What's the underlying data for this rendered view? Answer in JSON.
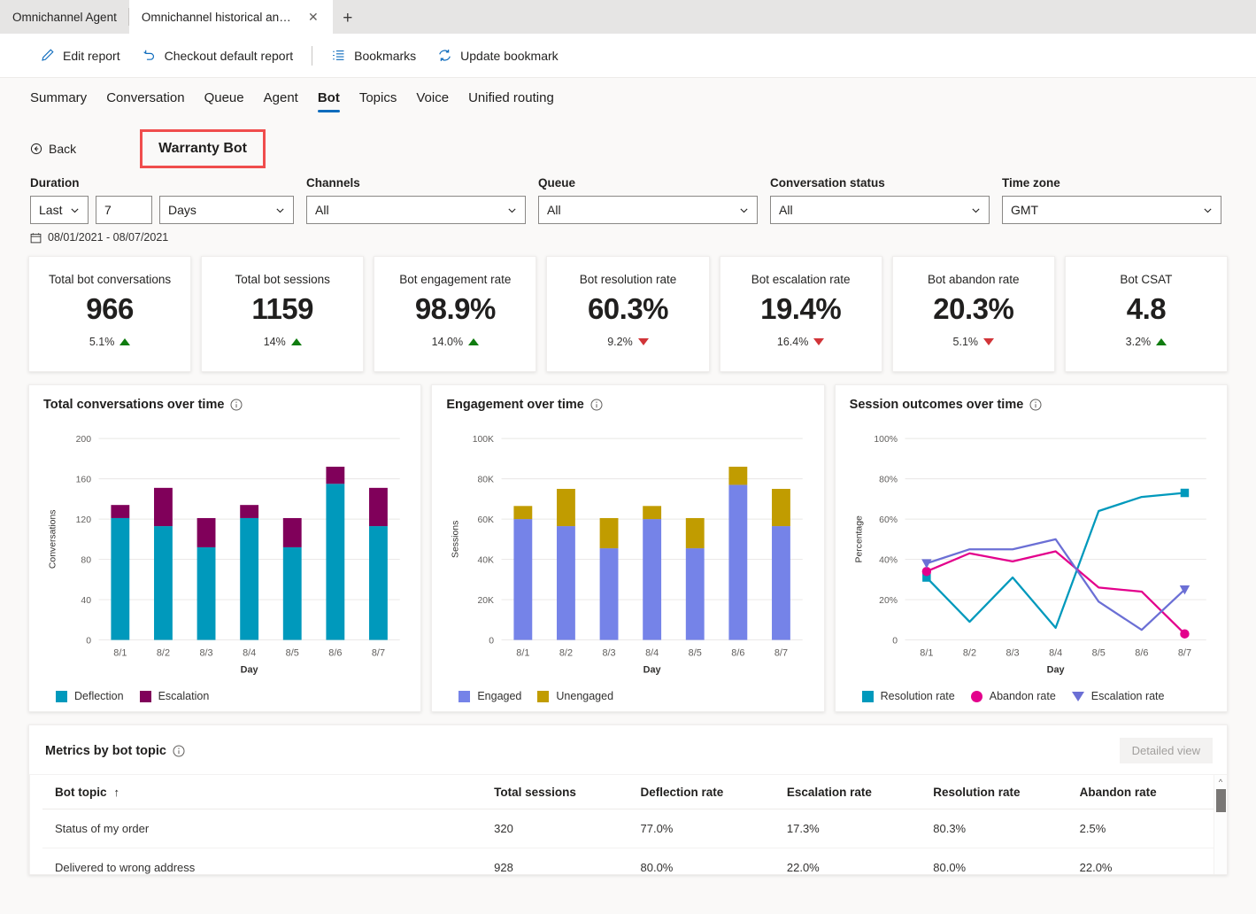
{
  "browser": {
    "tabs": [
      {
        "label": "Omnichannel Agent",
        "active": false
      },
      {
        "label": "Omnichannel historical ana...",
        "active": true
      }
    ],
    "close_label": "✕",
    "new_tab_label": "+"
  },
  "toolbar": {
    "items": [
      {
        "label": "Edit report",
        "icon": "pencil-icon"
      },
      {
        "label": "Checkout default report",
        "icon": "undo-icon"
      },
      {
        "label": "Bookmarks",
        "icon": "list-icon"
      },
      {
        "label": "Update bookmark",
        "icon": "refresh-icon"
      }
    ]
  },
  "nav": {
    "tabs": [
      {
        "label": "Summary",
        "active": false
      },
      {
        "label": "Conversation",
        "active": false
      },
      {
        "label": "Queue",
        "active": false
      },
      {
        "label": "Agent",
        "active": false
      },
      {
        "label": "Bot",
        "active": true
      },
      {
        "label": "Topics",
        "active": false
      },
      {
        "label": "Voice",
        "active": false
      },
      {
        "label": "Unified routing",
        "active": false
      }
    ]
  },
  "header": {
    "back_label": "Back",
    "bot_title": "Warranty Bot",
    "highlight_color": "#f04d4d"
  },
  "filters": {
    "duration": {
      "label": "Duration",
      "mode": "Last",
      "amount": "7",
      "unit": "Days",
      "date_range": "08/01/2021 - 08/07/2021"
    },
    "channels": {
      "label": "Channels",
      "value": "All"
    },
    "queue": {
      "label": "Queue",
      "value": "All"
    },
    "conversation_status": {
      "label": "Conversation status",
      "value": "All"
    },
    "time_zone": {
      "label": "Time zone",
      "value": "GMT"
    }
  },
  "kpis": [
    {
      "label": "Total bot conversations",
      "value": "966",
      "delta": "5.1%",
      "direction": "up"
    },
    {
      "label": "Total bot sessions",
      "value": "1159",
      "delta": "14%",
      "direction": "up"
    },
    {
      "label": "Bot engagement rate",
      "value": "98.9%",
      "delta": "14.0%",
      "direction": "up"
    },
    {
      "label": "Bot resolution rate",
      "value": "60.3%",
      "delta": "9.2%",
      "direction": "down"
    },
    {
      "label": "Bot escalation rate",
      "value": "19.4%",
      "delta": "16.4%",
      "direction": "down"
    },
    {
      "label": "Bot abandon rate",
      "value": "20.3%",
      "delta": "5.1%",
      "direction": "down"
    },
    {
      "label": "Bot CSAT",
      "value": "4.8",
      "delta": "3.2%",
      "direction": "up"
    }
  ],
  "chart_data": [
    {
      "type": "bar",
      "stacked": true,
      "title": "Total conversations over time",
      "xlabel": "Day",
      "ylabel": "Conversations",
      "categories": [
        "8/1",
        "8/2",
        "8/3",
        "8/4",
        "8/5",
        "8/6",
        "8/7"
      ],
      "ylim": [
        0,
        200
      ],
      "yticks": [
        0,
        40,
        80,
        120,
        160,
        200
      ],
      "ytick_labels": [
        "0",
        "40",
        "80",
        "120",
        "160",
        "200"
      ],
      "grid": true,
      "legend_position": "bottom",
      "series": [
        {
          "name": "Deflection",
          "color": "#0099bc",
          "values": [
            121,
            113,
            92,
            121,
            92,
            155,
            113
          ]
        },
        {
          "name": "Escalation",
          "color": "#80005a",
          "values": [
            13,
            38,
            29,
            13,
            29,
            17,
            38
          ]
        }
      ]
    },
    {
      "type": "bar",
      "stacked": true,
      "title": "Engagement over time",
      "xlabel": "Day",
      "ylabel": "Sessions",
      "categories": [
        "8/1",
        "8/2",
        "8/3",
        "8/4",
        "8/5",
        "8/6",
        "8/7"
      ],
      "ylim": [
        0,
        100000
      ],
      "yticks": [
        0,
        20000,
        40000,
        60000,
        80000,
        100000
      ],
      "ytick_labels": [
        "0",
        "20K",
        "40K",
        "60K",
        "80K",
        "100K"
      ],
      "grid": true,
      "legend_position": "bottom",
      "series": [
        {
          "name": "Engaged",
          "color": "#7583e8",
          "values": [
            60000,
            56500,
            45500,
            60000,
            45500,
            77000,
            56500
          ]
        },
        {
          "name": "Unengaged",
          "color": "#c19c00",
          "values": [
            6500,
            18500,
            15000,
            6500,
            15000,
            9000,
            18500
          ]
        }
      ]
    },
    {
      "type": "line",
      "title": "Session outcomes over time",
      "xlabel": "Day",
      "ylabel": "Percentage",
      "categories": [
        "8/1",
        "8/2",
        "8/3",
        "8/4",
        "8/5",
        "8/6",
        "8/7"
      ],
      "ylim": [
        0,
        100
      ],
      "yticks": [
        0,
        20,
        40,
        60,
        80,
        100
      ],
      "ytick_labels": [
        "0",
        "20%",
        "40%",
        "60%",
        "80%",
        "100%"
      ],
      "grid": true,
      "legend_position": "bottom",
      "series": [
        {
          "name": "Resolution rate",
          "color": "#0099bc",
          "marker": "square",
          "values": [
            31,
            9,
            31,
            6,
            64,
            71,
            73
          ]
        },
        {
          "name": "Abandon rate",
          "color": "#e3008c",
          "marker": "circle",
          "values": [
            34,
            43,
            39,
            44,
            26,
            24,
            3
          ]
        },
        {
          "name": "Escalation rate",
          "color": "#6b6fd5",
          "marker": "triangle",
          "values": [
            38,
            45,
            45,
            50,
            19,
            5,
            25
          ]
        }
      ]
    }
  ],
  "table": {
    "title": "Metrics by bot topic",
    "detailed_view_label": "Detailed view",
    "sort_column": "Bot topic",
    "sort_arrow": "↑",
    "columns": [
      "Bot topic",
      "Total sessions",
      "Deflection rate",
      "Escalation rate",
      "Resolution rate",
      "Abandon rate"
    ],
    "rows": [
      {
        "topic": "Status of my order",
        "total_sessions": "320",
        "deflection_rate": "77.0%",
        "escalation_rate": "17.3%",
        "resolution_rate": "80.3%",
        "abandon_rate": "2.5%"
      },
      {
        "topic": "Delivered to wrong address",
        "total_sessions": "928",
        "deflection_rate": "80.0%",
        "escalation_rate": "22.0%",
        "resolution_rate": "80.0%",
        "abandon_rate": "22.0%"
      }
    ]
  }
}
